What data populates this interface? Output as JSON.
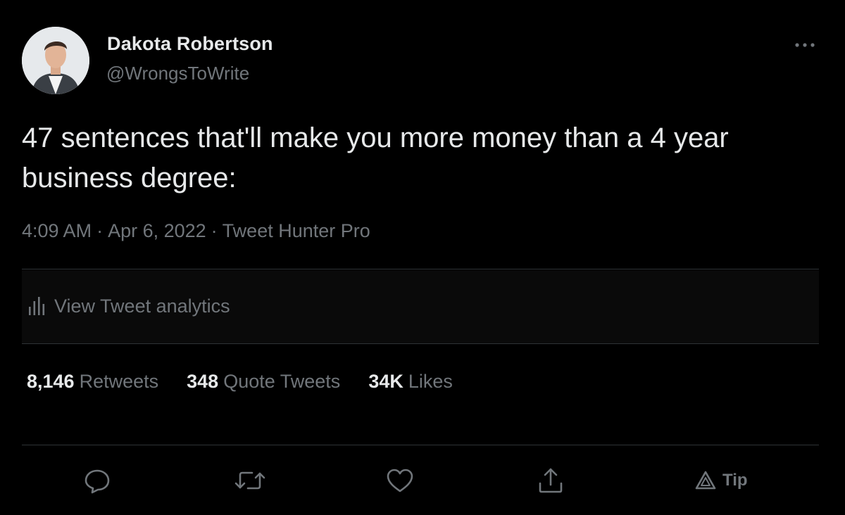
{
  "author": {
    "name": "Dakota Robertson",
    "handle": "@WrongsToWrite"
  },
  "tweet": {
    "text": "47 sentences that'll make you more money than a 4 year business degree:",
    "time": "4:09 AM",
    "date": "Apr 6, 2022",
    "source": "Tweet Hunter Pro",
    "separator": "·"
  },
  "analytics": {
    "label": "View Tweet analytics"
  },
  "stats": [
    {
      "count": "8,146",
      "label": "Retweets"
    },
    {
      "count": "348",
      "label": "Quote Tweets"
    },
    {
      "count": "34K",
      "label": "Likes"
    }
  ],
  "actions": {
    "tip_label": "Tip"
  },
  "colors": {
    "background": "#000000",
    "primary_text": "#e7e9ea",
    "secondary_text": "#71767b",
    "divider": "#2f3336"
  },
  "icons": [
    "more-icon",
    "analytics-icon",
    "reply-icon",
    "retweet-icon",
    "like-icon",
    "share-icon",
    "tip-icon"
  ]
}
